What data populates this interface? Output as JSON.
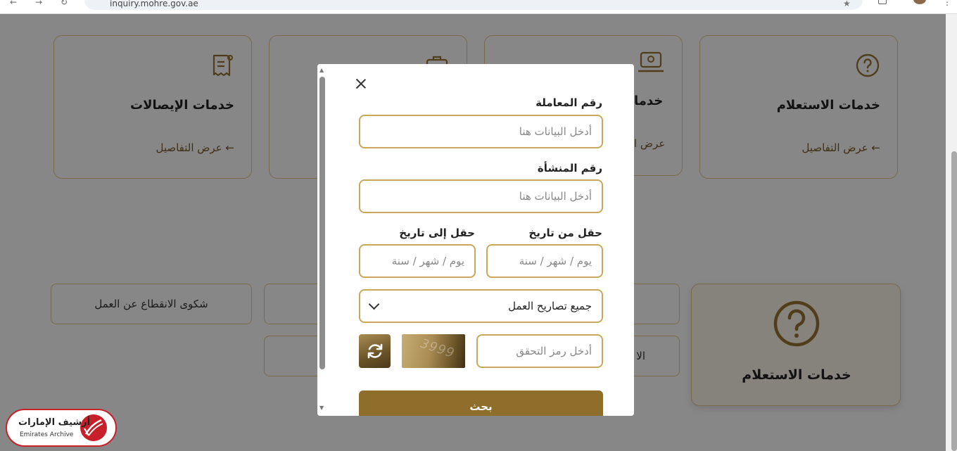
{
  "browser": {
    "url": "inquiry.mohre.gov.ae"
  },
  "service_cards": [
    {
      "title": "خدمات الإيصالات",
      "link": "عرض التفاصيل",
      "icon": "receipt-icon"
    },
    {
      "title": "",
      "link": "",
      "icon": "briefcase-icon"
    },
    {
      "title": "خدما",
      "link": "عرض ا",
      "icon": "laptop-user-icon"
    },
    {
      "title": "خدمات الاستعلام",
      "link": "عرض التفاصيل",
      "icon": "question-circle-icon"
    }
  ],
  "pills": {
    "absence_complaint": "شكوى الانقطاع عن العمل",
    "partial_right": "الا"
  },
  "active_card": {
    "title": "خدمات الاستعلام",
    "icon": "question-circle-icon"
  },
  "modal": {
    "transaction_label": "رقم المعاملة",
    "transaction_placeholder": "أدخل البيانات هنا",
    "establishment_label": "رقم المنشأة",
    "establishment_placeholder": "أدخل البيانات هنا",
    "from_date_label": "حقل من تاريخ",
    "from_date_placeholder": "يوم / شهر / سنة",
    "to_date_label": "حقل إلى تاريخ",
    "to_date_placeholder": "يوم / شهر / سنة",
    "permit_type_selected": "جميع تصاريح العمل",
    "captcha_placeholder": "أدخل رمز التحقق",
    "captcha_code": "3999",
    "search_label": "بحث"
  },
  "logo": {
    "arabic": "أرشيف الإمارات",
    "english": "Emirates Archive"
  },
  "colors": {
    "gold": "#c9a75c",
    "gold_dark": "#8f6e2c",
    "brand_red": "#c8202a"
  }
}
